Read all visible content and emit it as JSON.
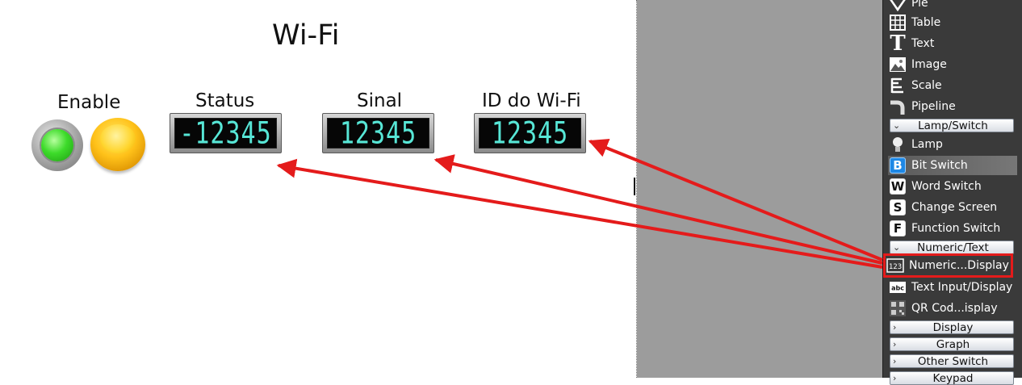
{
  "canvas": {
    "title": "Wi-Fi",
    "labels": {
      "enable": "Enable",
      "status": "Status",
      "sinal": "Sinal",
      "wifi_id": "ID do Wi-Fi"
    },
    "displays": {
      "status": "-12345",
      "sinal": "12345",
      "wifi_id": "12345"
    }
  },
  "toolbox": {
    "items_top": [
      {
        "label": "Pie",
        "icon": "pie-icon"
      },
      {
        "label": "Table",
        "icon": "table-icon"
      },
      {
        "label": "Text",
        "icon": "text-icon"
      },
      {
        "label": "Image",
        "icon": "image-icon"
      },
      {
        "label": "Scale",
        "icon": "scale-icon"
      },
      {
        "label": "Pipeline",
        "icon": "pipeline-icon"
      }
    ],
    "cat_lamp_switch": "Lamp/Switch",
    "items_lamp": [
      {
        "label": "Lamp",
        "icon": "lamp-icon"
      },
      {
        "label": "Bit Switch",
        "icon": "bit-switch-icon",
        "letter": "B"
      },
      {
        "label": "Word Switch",
        "icon": "word-switch-icon",
        "letter": "W"
      },
      {
        "label": "Change Screen",
        "icon": "change-screen-icon",
        "letter": "S"
      },
      {
        "label": "Function Switch",
        "icon": "function-switch-icon",
        "letter": "F"
      }
    ],
    "cat_numeric_text": "Numeric/Text",
    "items_numeric": [
      {
        "label": "Numeric...Display",
        "icon": "numeric-display-icon"
      },
      {
        "label": "Text Input/Display",
        "icon": "text-input-icon"
      },
      {
        "label": "QR Cod...isplay",
        "icon": "qr-code-icon"
      }
    ],
    "cat_display": "Display",
    "cat_graph": "Graph",
    "cat_other_switch": "Other Switch",
    "cat_keypad": "Keypad"
  },
  "colors": {
    "annotation_red": "#e41b1b",
    "display_digits": "#57e6d6",
    "selected_bit_switch_bg": "#5b5b5b"
  }
}
